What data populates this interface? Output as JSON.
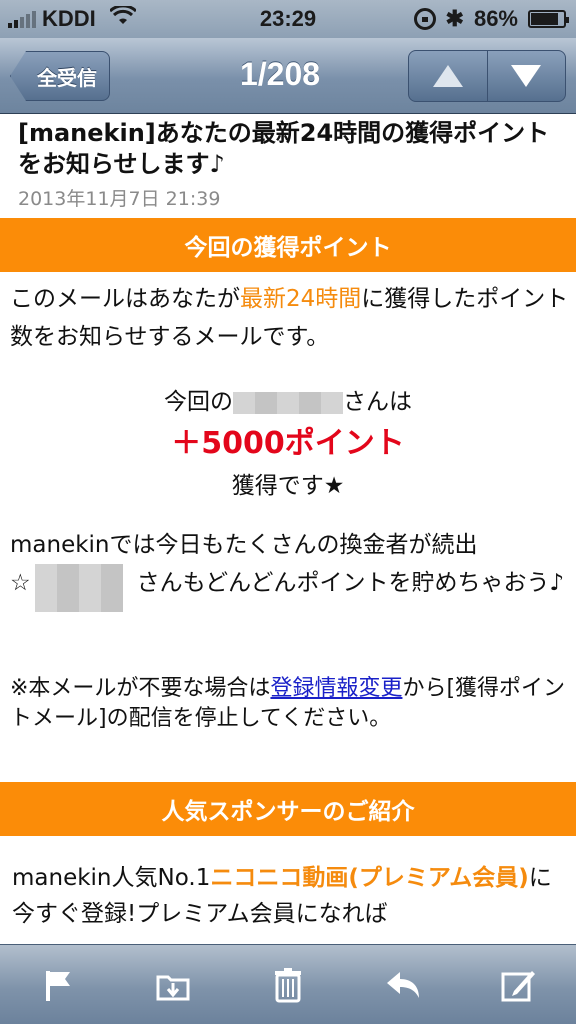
{
  "status_bar": {
    "carrier": "KDDI",
    "time": "23:29",
    "battery": "86%",
    "battery_level": 0.86,
    "icons": [
      "signal-icon",
      "wifi-icon",
      "rotation-lock-icon",
      "bluetooth-icon",
      "battery-icon"
    ]
  },
  "nav": {
    "back_label": "全受信",
    "title": "1/208",
    "icons": [
      "up-arrow-icon",
      "down-arrow-icon"
    ]
  },
  "mail": {
    "subject": "[manekin]あなたの最新24時間の獲得ポイントをお知らせします♪",
    "date": "2013年11月7日 21:39"
  },
  "section1": {
    "title": "今回の獲得ポイント"
  },
  "intro": {
    "part1": "このメールはあなたが",
    "highlight": "最新24時間",
    "part2": "に獲得したポイント数をお知らせするメールです。"
  },
  "points": {
    "line1_prefix": "今回の",
    "line1_suffix": "さんは",
    "amount": "＋5000ポイント",
    "line3": "獲得です★"
  },
  "message": {
    "line1": "manekinでは今日もたくさんの換金者が続出",
    "line2_prefix": "☆",
    "line2_suffix": "さんもどんどんポイントを貯めちゃおう♪"
  },
  "notice": {
    "prefix": "※本メールが不要な場合は",
    "link": "登録情報変更",
    "suffix": "から[獲得ポイントメール]の配信を停止してください。"
  },
  "section2": {
    "title": "人気スポンサーのご紹介"
  },
  "sponsor": {
    "prefix": "manekin人気No.1",
    "link": "ニコニコ動画(プレミアム会員)",
    "suffix": "に今すぐ登録!プレミアム会員になれば"
  },
  "toolbar": {
    "icons": [
      "flag-icon",
      "move-to-folder-icon",
      "trash-icon",
      "reply-icon",
      "compose-icon"
    ]
  }
}
